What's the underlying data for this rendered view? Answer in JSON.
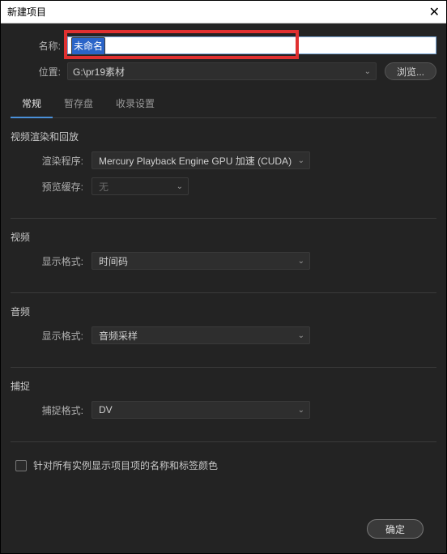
{
  "window": {
    "title": "新建项目"
  },
  "name": {
    "label": "名称:",
    "value": "未命名"
  },
  "location": {
    "label": "位置:",
    "value": "G:\\pr19素材",
    "browse": "浏览..."
  },
  "tabs": {
    "general": "常规",
    "scratch": "暂存盘",
    "ingest": "收录设置"
  },
  "render": {
    "group": "视频渲染和回放",
    "engine_label": "渲染程序:",
    "engine_value": "Mercury Playback Engine GPU 加速 (CUDA)",
    "cache_label": "预览缓存:",
    "cache_value": "无"
  },
  "video": {
    "group": "视频",
    "format_label": "显示格式:",
    "format_value": "时间码"
  },
  "audio": {
    "group": "音频",
    "format_label": "显示格式:",
    "format_value": "音频采样"
  },
  "capture": {
    "group": "捕捉",
    "format_label": "捕捉格式:",
    "format_value": "DV"
  },
  "checkbox": {
    "label": "针对所有实例显示项目项的名称和标签颜色"
  },
  "footer": {
    "ok": "确定"
  }
}
